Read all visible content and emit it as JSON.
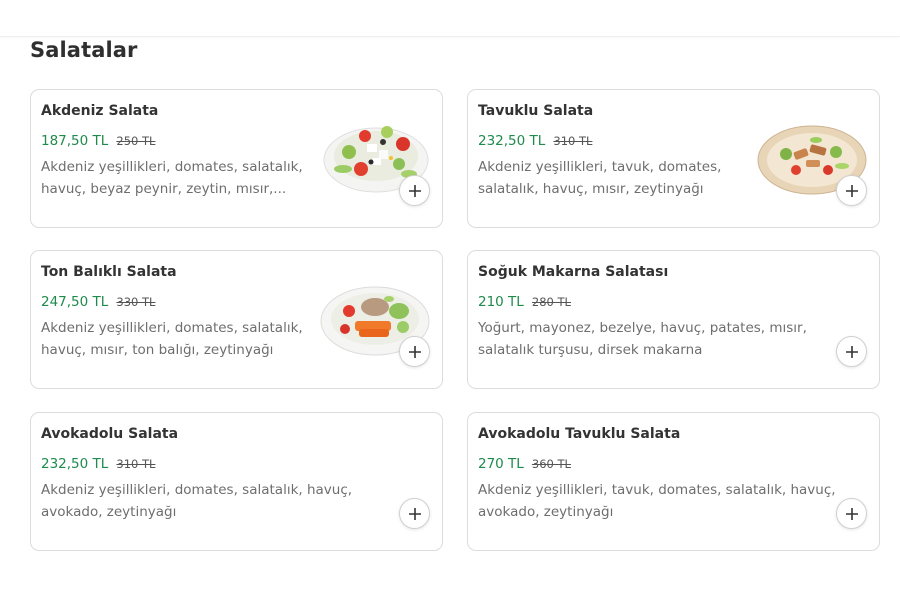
{
  "section": {
    "title": "Salatalar"
  },
  "items": [
    {
      "name": "Akdeniz Salata",
      "price": "187,50 TL",
      "old_price": "250 TL",
      "description": "Akdeniz yeşillikleri, domates, salatalık, havuç, beyaz peynir, zeytin, mısır,...",
      "image": "mediterranean-salad-photo",
      "add_icon": "plus-icon"
    },
    {
      "name": "Tavuklu Salata",
      "price": "232,50 TL",
      "old_price": "310 TL",
      "description": "Akdeniz yeşillikleri, tavuk, domates, salatalık, havuç, mısır, zeytinyağı",
      "image": "chicken-salad-photo",
      "add_icon": "plus-icon"
    },
    {
      "name": "Ton Balıklı Salata",
      "price": "247,50 TL",
      "old_price": "330 TL",
      "description": "Akdeniz yeşillikleri, domates, salatalık, havuç, mısır, ton balığı, zeytinyağı",
      "image": "tuna-salad-photo",
      "add_icon": "plus-icon"
    },
    {
      "name": "Soğuk Makarna Salatası",
      "price": "210 TL",
      "old_price": "280 TL",
      "description": "Yoğurt, mayonez, bezelye, havuç, patates, mısır, salatalık turşusu, dirsek makarna",
      "add_icon": "plus-icon"
    },
    {
      "name": "Avokadolu Salata",
      "price": "232,50 TL",
      "old_price": "310 TL",
      "description": "Akdeniz yeşillikleri, domates, salatalık, havuç, avokado, zeytinyağı",
      "add_icon": "plus-icon"
    },
    {
      "name": "Avokadolu Tavuklu Salata",
      "price": "270 TL",
      "old_price": "360 TL",
      "description": "Akdeniz yeşillikleri, tavuk, domates, salatalık, havuç, avokado, zeytinyağı",
      "add_icon": "plus-icon"
    }
  ],
  "colors": {
    "price": "#1f8a4c",
    "card_border": "#dcdcdc",
    "title": "#2f2f2f"
  }
}
